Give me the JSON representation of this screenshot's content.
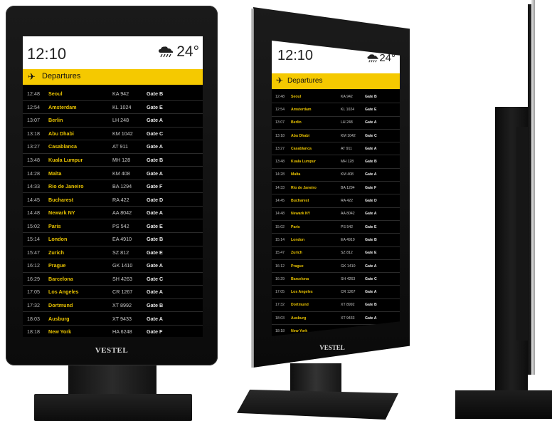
{
  "brand": "VESTEL",
  "board": {
    "time": "12:10",
    "temperature": "24°",
    "weather_icon": "rain-cloud-icon",
    "section_icon": "departure-plane-icon",
    "section_title": "Departures",
    "flights": [
      {
        "time": "12:48",
        "city": "Seoul",
        "flight": "KA 942",
        "gate": "Gate B"
      },
      {
        "time": "12:54",
        "city": "Amsterdam",
        "flight": "KL 1024",
        "gate": "Gate E"
      },
      {
        "time": "13:07",
        "city": "Berlin",
        "flight": "LH 248",
        "gate": "Gate A"
      },
      {
        "time": "13:18",
        "city": "Abu Dhabi",
        "flight": "KM 1042",
        "gate": "Gate C"
      },
      {
        "time": "13:27",
        "city": "Casablanca",
        "flight": "AT 911",
        "gate": "Gate A"
      },
      {
        "time": "13:48",
        "city": "Kuala Lumpur",
        "flight": "MH 128",
        "gate": "Gate B"
      },
      {
        "time": "14:28",
        "city": "Malta",
        "flight": "KM 408",
        "gate": "Gate A"
      },
      {
        "time": "14:33",
        "city": "Rio de Janeiro",
        "flight": "BA 1294",
        "gate": "Gate F"
      },
      {
        "time": "14:45",
        "city": "Bucharest",
        "flight": "RA 422",
        "gate": "Gate D"
      },
      {
        "time": "14:48",
        "city": "Newark NY",
        "flight": "AA 8042",
        "gate": "Gate A"
      },
      {
        "time": "15:02",
        "city": "Paris",
        "flight": "PS 542",
        "gate": "Gate E"
      },
      {
        "time": "15:14",
        "city": "London",
        "flight": "EA 4910",
        "gate": "Gate B"
      },
      {
        "time": "15:47",
        "city": "Zurich",
        "flight": "SZ 812",
        "gate": "Gate E"
      },
      {
        "time": "16:12",
        "city": "Prague",
        "flight": "GK 1410",
        "gate": "Gate A"
      },
      {
        "time": "16:29",
        "city": "Barcelona",
        "flight": "SH 4263",
        "gate": "Gate C"
      },
      {
        "time": "17:05",
        "city": "Los Angeles",
        "flight": "CR 1267",
        "gate": "Gate A"
      },
      {
        "time": "17:32",
        "city": "Dortmund",
        "flight": "XT 8992",
        "gate": "Gate B"
      },
      {
        "time": "18:03",
        "city": "Ausburg",
        "flight": "XT 9433",
        "gate": "Gate A"
      },
      {
        "time": "18:18",
        "city": "New York",
        "flight": "HA 6248",
        "gate": "Gate F"
      }
    ]
  },
  "colors": {
    "accent": "#f5c900",
    "city_text": "#e8c200",
    "screen_bg": "#000000",
    "bezel": "#111111"
  }
}
